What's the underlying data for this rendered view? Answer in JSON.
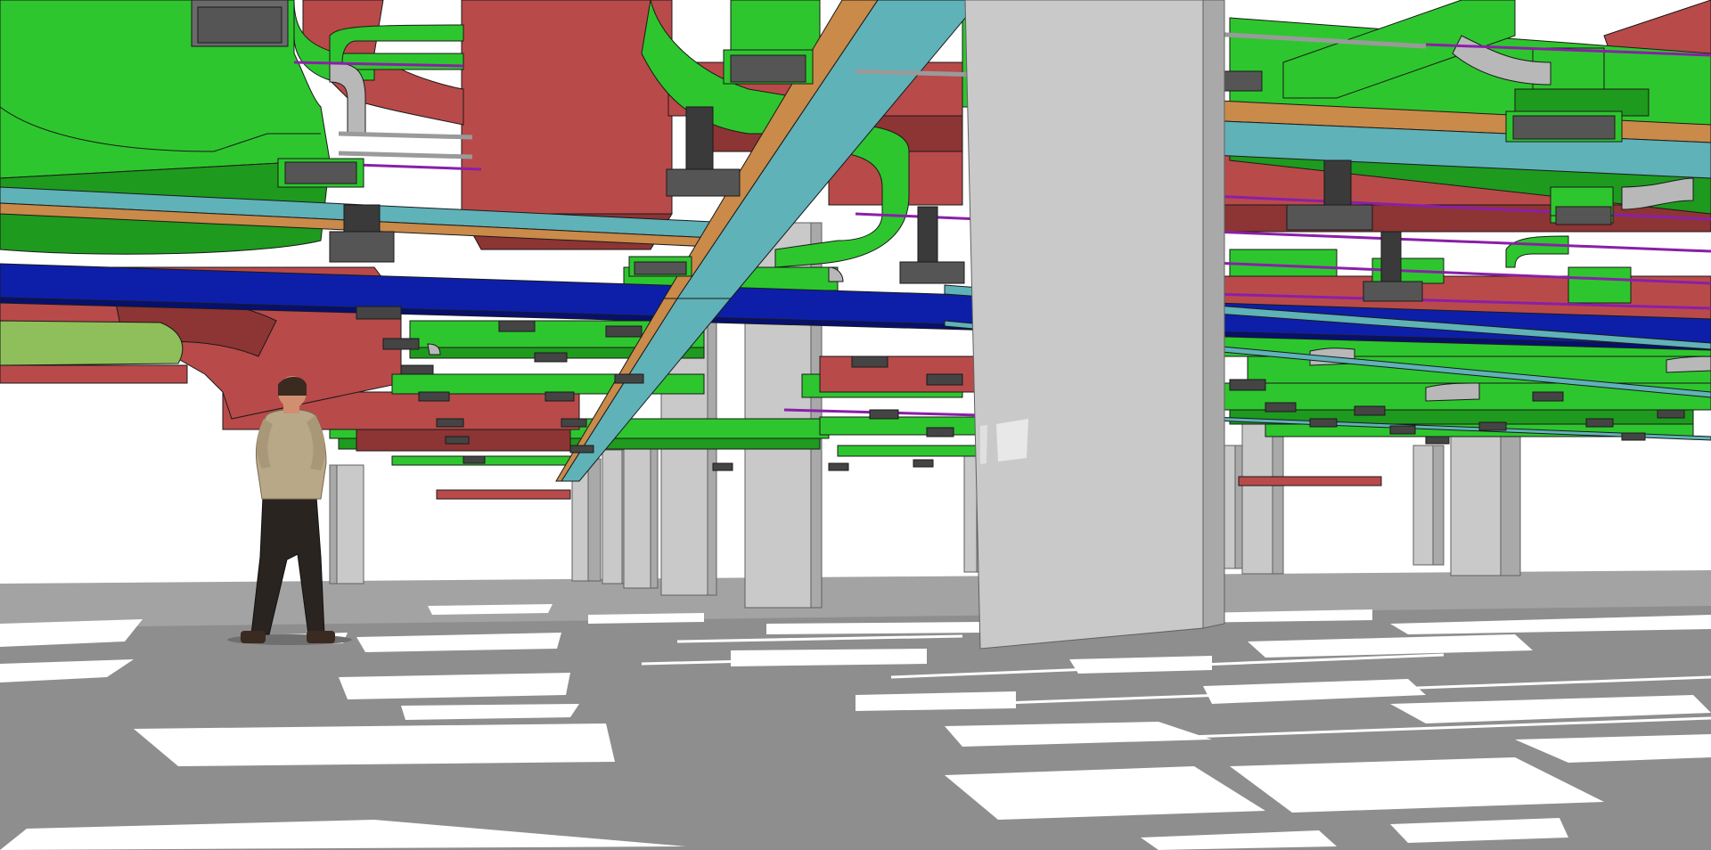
{
  "scene": {
    "kind": "3d-model-viewport",
    "render_style": "flat-shaded-with-edges",
    "palette": {
      "background": "#ffffff",
      "floor_shadow": "#8e8e8e",
      "floor_light": "#ffffff",
      "column_face": "#c9c9c9",
      "column_side": "#a9a9a9",
      "supply_duct": "#2ec62e",
      "supply_duct_dark": "#1e9a1e",
      "return_duct": "#b94a4a",
      "return_duct_dark": "#8d3434",
      "beam_blue": "#0d1fa8",
      "beam_teal": "#5fb2b8",
      "beam_orange": "#c98a4a",
      "pipe_purple": "#8a1fa8",
      "diffuser": "#555555",
      "hanger_gray": "#b8b8b8",
      "olive_duct": "#8fbf5a"
    },
    "figure": {
      "kind": "standing-person",
      "shirt": "#b8a888",
      "trousers": "#2a2420",
      "skin": "#d09070",
      "hair": "#3a2a20"
    }
  }
}
